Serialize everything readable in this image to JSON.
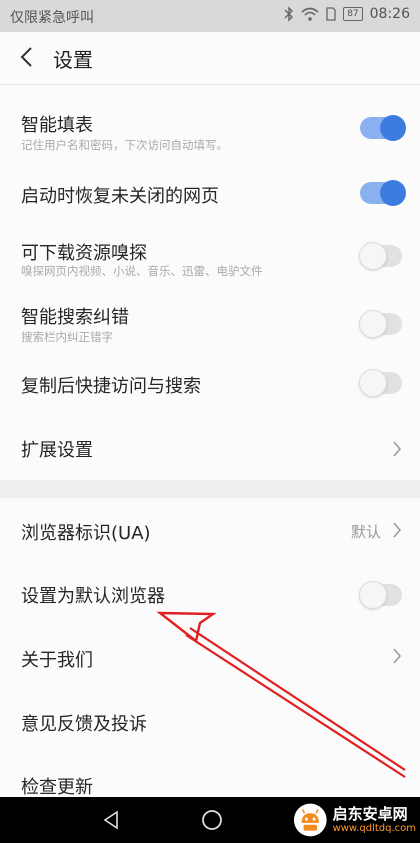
{
  "status_bar": {
    "left_text": "仅限紧急呼叫",
    "battery": "87",
    "time": "08:26"
  },
  "header": {
    "title": "设置"
  },
  "settings": [
    {
      "label": "智能填表",
      "sub": "记住用户名和密码，下次访问自动填写。",
      "toggle": "on"
    },
    {
      "label": "启动时恢复未关闭的网页",
      "toggle": "on"
    },
    {
      "label": "可下载资源嗅探",
      "sub": "嗅探网页内视频、小说、音乐、迅雷、电驴文件",
      "toggle": "off"
    },
    {
      "label": "智能搜索纠错",
      "sub": "搜索栏内纠正错字",
      "toggle": "off"
    },
    {
      "label": "复制后快捷访问与搜索",
      "toggle": "off"
    },
    {
      "label": "扩展设置"
    }
  ],
  "settings2": [
    {
      "label": "浏览器标识(UA)",
      "value": "默认"
    },
    {
      "label": "设置为默认浏览器",
      "toggle": "off"
    },
    {
      "label": "关于我们"
    },
    {
      "label": "意见反馈及投诉"
    },
    {
      "label": "检查更新"
    }
  ],
  "watermark": {
    "title": "启东安卓网",
    "url": "www.qdltdq.com"
  },
  "colors": {
    "toggle_on": "#3d7cdf",
    "toggle_on_track": "#8ab1ef",
    "arrow": "#e02020",
    "watermark_url": "#ff9a2e"
  }
}
